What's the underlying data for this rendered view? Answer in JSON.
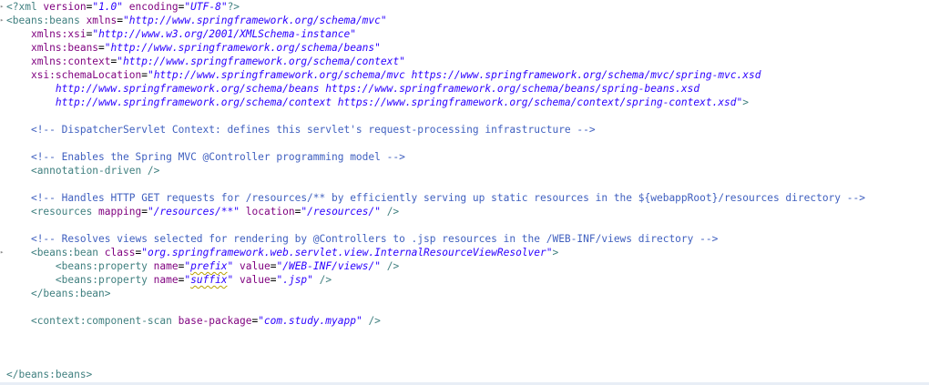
{
  "xml_decl": {
    "open": "<?xml ",
    "version_attr": "version",
    "version_val": "\"1.0\"",
    "encoding_attr": "encoding",
    "encoding_val": "\"UTF-8\"",
    "close": "?>"
  },
  "root_open": {
    "tag": "<beans:beans ",
    "xmlns_attr": "xmlns",
    "xmlns_val": "\"http://www.springframework.org/schema/mvc\""
  },
  "ns": [
    {
      "attr": "xmlns:xsi",
      "val": "\"http://www.w3.org/2001/XMLSchema-instance\""
    },
    {
      "attr": "xmlns:beans",
      "val": "\"http://www.springframework.org/schema/beans\""
    },
    {
      "attr": "xmlns:context",
      "val": "\"http://www.springframework.org/schema/context\""
    }
  ],
  "schema": {
    "attr": "xsi:schemaLocation",
    "line1": "\"http://www.springframework.org/schema/mvc https://www.springframework.org/schema/mvc/spring-mvc.xsd",
    "line2": "http://www.springframework.org/schema/beans https://www.springframework.org/schema/beans/spring-beans.xsd",
    "line3": "http://www.springframework.org/schema/context https://www.springframework.org/schema/context/spring-context.xsd\"",
    "close": ">"
  },
  "comments": {
    "c1": "<!-- DispatcherServlet Context: defines this servlet's request-processing infrastructure -->",
    "c2": "<!-- Enables the Spring MVC @Controller programming model -->",
    "c3": "<!-- Handles HTTP GET requests for /resources/** by efficiently serving up static resources in the ${webappRoot}/resources directory -->",
    "c4": "<!-- Resolves views selected for rendering by @Controllers to .jsp resources in the /WEB-INF/views directory -->"
  },
  "annotation": {
    "text": "<annotation-driven />"
  },
  "resources": {
    "open": "<resources ",
    "mapping_attr": "mapping",
    "mapping_val": "\"/resources/**\"",
    "location_attr": "location",
    "location_val": "\"/resources/\"",
    "close": " />"
  },
  "bean": {
    "open": "<beans:bean ",
    "class_attr": "class",
    "class_val": "\"org.springframework.web.servlet.view.InternalResourceViewResolver\"",
    "close": ">",
    "end": "</beans:bean>"
  },
  "props": [
    {
      "open": "<beans:property ",
      "name_attr": "name",
      "q1": "\"",
      "name_word": "prefix",
      "q2": "\"",
      "value_attr": "value",
      "value_val": "\"/WEB-INF/views/\"",
      "close": " />"
    },
    {
      "open": "<beans:property ",
      "name_attr": "name",
      "q1": "\"",
      "name_word": "suffix",
      "q2": "\"",
      "value_attr": "value",
      "value_val": "\".jsp\"",
      "close": " />"
    }
  ],
  "scan": {
    "open": "<context:component-scan ",
    "attr": "base-package",
    "val": "\"com.study.myapp\"",
    "close": " />"
  },
  "root_close": {
    "text": "</beans:beans>"
  },
  "colors": {
    "tag": "#3f7f7f",
    "attribute": "#7f007f",
    "value": "#2a00ff",
    "comment": "#3f5fbf"
  }
}
